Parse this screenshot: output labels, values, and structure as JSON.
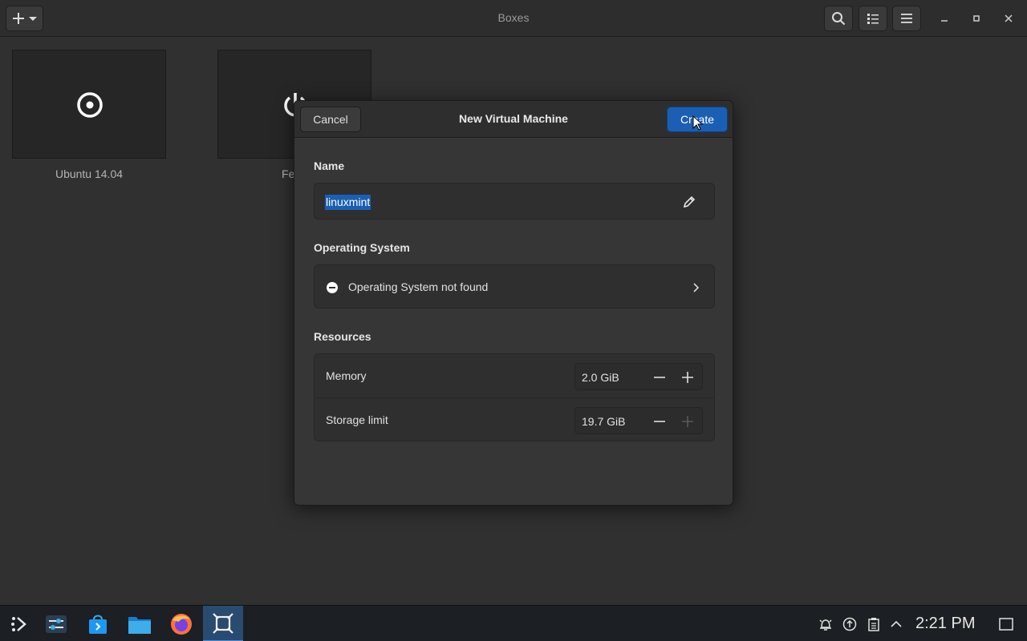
{
  "window": {
    "title": "Boxes",
    "add_icon": "plus-icon",
    "add_menu_icon": "chevron-down-icon",
    "search_icon": "search-icon",
    "view_icon": "list-view-icon",
    "menu_icon": "hamburger-menu-icon"
  },
  "boxes": [
    {
      "label": "Ubuntu 14.04",
      "icon": "disc-icon"
    },
    {
      "label": "Fedo",
      "icon": "power-icon"
    }
  ],
  "dialog": {
    "title": "New Virtual Machine",
    "cancel_label": "Cancel",
    "create_label": "Create",
    "name_section": "Name",
    "name_value": "linuxmint",
    "os_section": "Operating System",
    "os_value": "Operating System not found",
    "resources_section": "Resources",
    "resources": [
      {
        "label": "Memory",
        "value": "2.0 GiB",
        "plus_enabled": true
      },
      {
        "label": "Storage limit",
        "value": "19.7 GiB",
        "plus_enabled": false
      }
    ]
  },
  "taskbar": {
    "apps": [
      "app-launcher-icon",
      "system-settings-icon",
      "software-store-icon",
      "file-manager-icon",
      "firefox-icon",
      "boxes-icon"
    ],
    "tray": [
      "notifications-icon",
      "updates-icon",
      "clipboard-icon",
      "tray-expand-icon"
    ],
    "clock": "2:21 PM"
  },
  "colors": {
    "accent": "#1a5fb4",
    "background": "#303030"
  }
}
